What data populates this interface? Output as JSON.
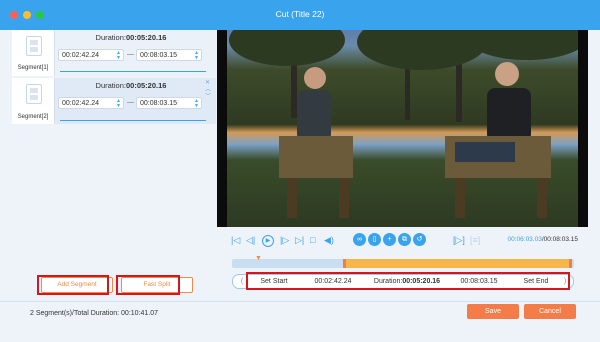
{
  "window": {
    "title": "Cut (Title 22)",
    "controls": [
      "close",
      "minimize",
      "maximize"
    ]
  },
  "segments": [
    {
      "label": "Segment[1]",
      "duration_label": "Duration:",
      "duration_value": "00:05:20.16",
      "start": "00:02:42.24",
      "end": "00:08:03.15",
      "dash": "—",
      "selected": false
    },
    {
      "label": "Segment[2]",
      "duration_label": "Duration:",
      "duration_value": "00:05:20.16",
      "start": "00:02:42.24",
      "end": "00:08:03.15",
      "dash": "—",
      "selected": true
    }
  ],
  "actions": {
    "add_segment": "Add Segment",
    "fast_split": "Fast Split"
  },
  "player": {
    "current_time": "00:06:03.03",
    "total_time": "/00:08:03.15"
  },
  "set_row": {
    "set_start": "Set Start",
    "start_value": "00:02:42.24",
    "duration_label": "Duration:",
    "duration_value": "00:05:20.16",
    "end_value": "00:08:03.15",
    "set_end": "Set End"
  },
  "footer": {
    "summary": "2 Segment(s)/Total Duration: 00:10:41.07",
    "save": "Save",
    "cancel": "Cancel"
  },
  "colors": {
    "accent": "#3aa3ee",
    "orange": "#f37c48",
    "highlight": "#d5161b"
  }
}
